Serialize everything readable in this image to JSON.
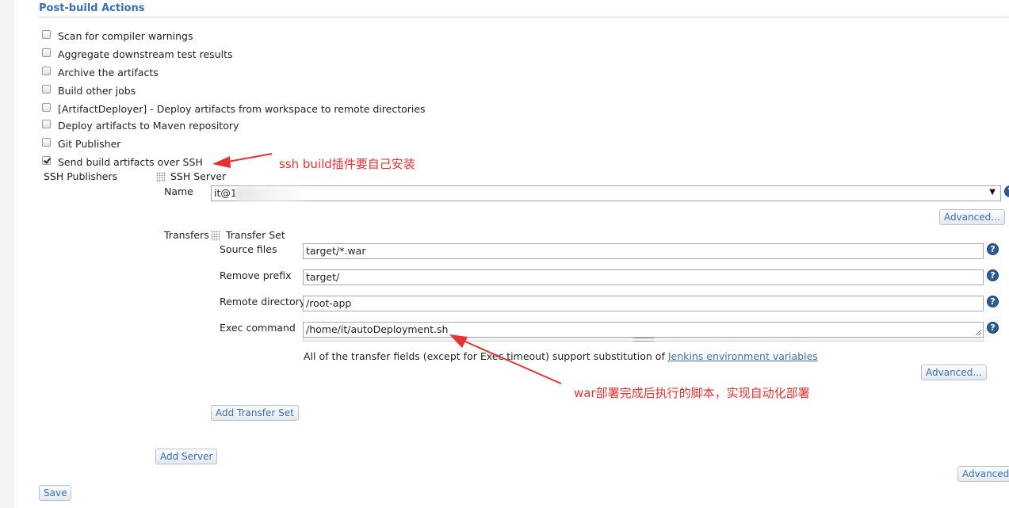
{
  "section": {
    "title": "Post-build Actions"
  },
  "checkboxes": [
    {
      "label": "Scan for compiler warnings",
      "checked": false
    },
    {
      "label": "Aggregate downstream test results",
      "checked": false
    },
    {
      "label": "Archive the artifacts",
      "checked": false
    },
    {
      "label": "Build other jobs",
      "checked": false
    },
    {
      "label": "[ArtifactDeployer] - Deploy artifacts from workspace to remote directories",
      "checked": false
    },
    {
      "label": "Deploy artifacts to Maven repository",
      "checked": false
    },
    {
      "label": "Git Publisher",
      "checked": false
    },
    {
      "label": "Send build artifacts over SSH",
      "checked": true
    }
  ],
  "ssh": {
    "publishers_label": "SSH Publishers",
    "server_header": "SSH Server",
    "name_label": "Name",
    "name_value": "it@1",
    "advanced_label": "Advanced...",
    "transfers_label": "Transfers",
    "transfer_set_header": "Transfer Set",
    "fields": {
      "source_files": {
        "label": "Source files",
        "value": "target/*.war"
      },
      "remove_prefix": {
        "label": "Remove prefix",
        "value": "target/"
      },
      "remote_directory": {
        "label": "Remote directory",
        "value": "/root-app"
      },
      "exec_command": {
        "label": "Exec command",
        "value": "/home/it/autoDeployment.sh"
      }
    },
    "info_text": "All of the transfer fields (except for Exec timeout) support substitution of ",
    "info_link": "Jenkins environment variables",
    "transfer_advanced_label": "Advanced...",
    "add_transfer_set_label": "Add Transfer Set",
    "add_server_label": "Add Server",
    "bottom_advanced_label": "Advanced..."
  },
  "save_label": "Save",
  "annotations": {
    "ssh_plugin_note": "ssh build插件要自己安装",
    "war_script_note": "war部署完成后执行的脚本，实现自动化部署",
    "color": "#e53333"
  },
  "icons": {
    "help": "help-icon",
    "drag": "drag-handle-icon",
    "dropdown": "dropdown-arrow-icon"
  }
}
